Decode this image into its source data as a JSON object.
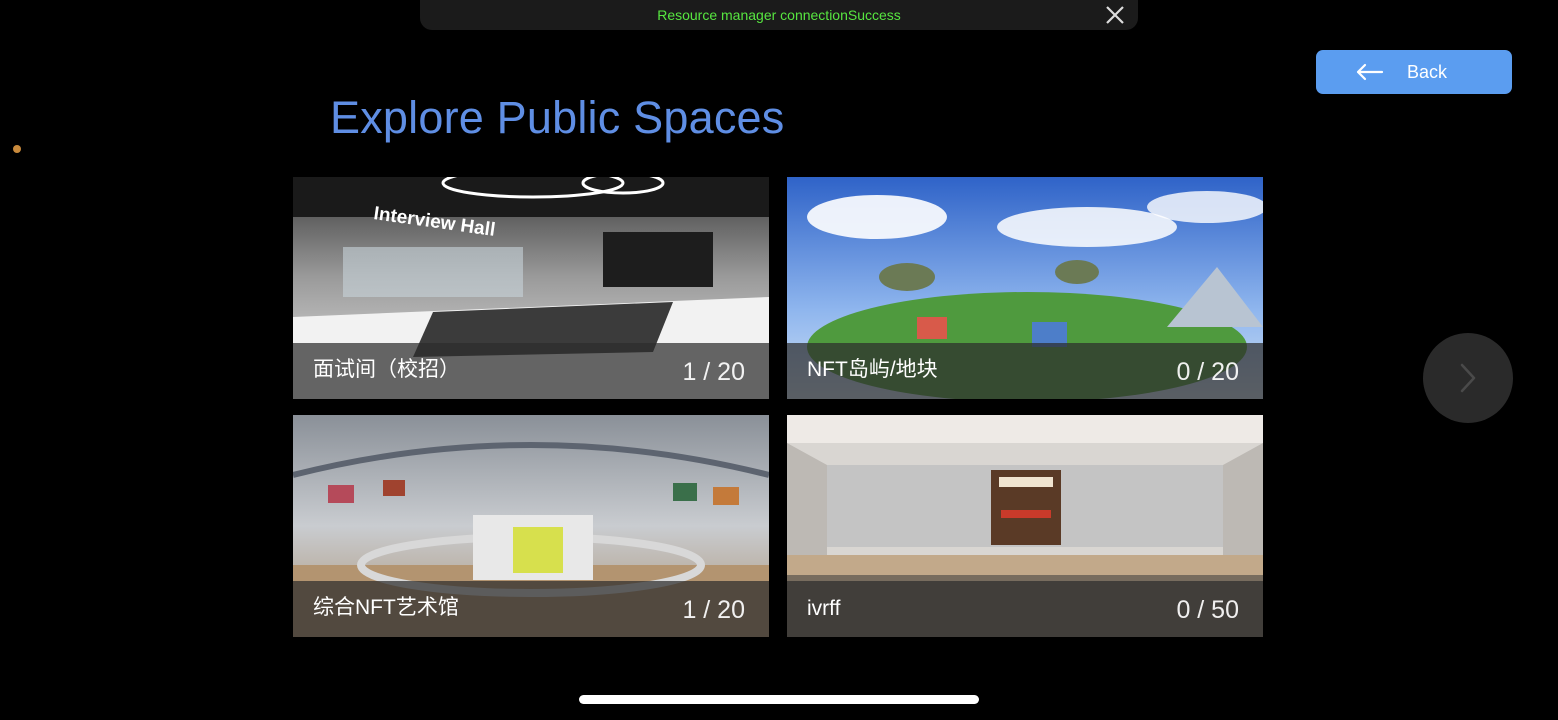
{
  "toast": {
    "message": "Resource manager connectionSuccess",
    "close_icon": "close-icon"
  },
  "header": {
    "back_label": "Back",
    "back_icon": "arrow-left-icon"
  },
  "page": {
    "title": "Explore Public Spaces"
  },
  "spaces": [
    {
      "name": "面试间（校招）",
      "count": "1 / 20",
      "thumbnail_text": "Interview Hall"
    },
    {
      "name": "NFT岛屿/地块",
      "count": "0 / 20"
    },
    {
      "name": "综合NFT艺术馆",
      "count": "1 / 20"
    },
    {
      "name": "ivrff",
      "count": "0 / 50"
    }
  ],
  "pager": {
    "next_icon": "chevron-right-icon"
  },
  "colors": {
    "accent": "#5b9df0",
    "title": "#5f8ee4",
    "toast_text": "#57e640"
  }
}
